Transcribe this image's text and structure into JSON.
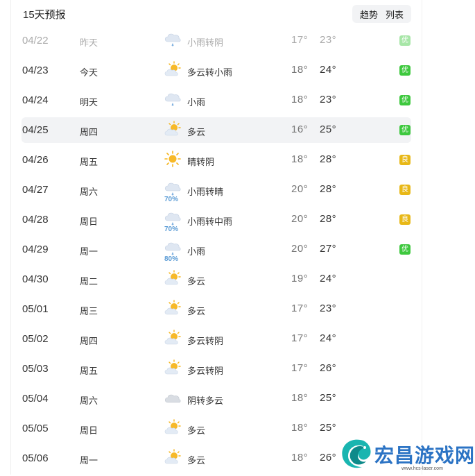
{
  "header": {
    "title": "15天预报",
    "trend_label": "趋势",
    "list_label": "列表"
  },
  "rows": [
    {
      "date": "04/22",
      "day": "昨天",
      "icon": "light-rain-icon",
      "pop": "",
      "condition": "小雨转阴",
      "low": "17°",
      "high": "23°",
      "aqi": "优",
      "aqi_level": "good",
      "past": true
    },
    {
      "date": "04/23",
      "day": "今天",
      "icon": "partly-cloudy-icon",
      "pop": "",
      "condition": "多云转小雨",
      "low": "18°",
      "high": "24°",
      "aqi": "优",
      "aqi_level": "good"
    },
    {
      "date": "04/24",
      "day": "明天",
      "icon": "light-rain-icon",
      "pop": "",
      "condition": "小雨",
      "low": "18°",
      "high": "23°",
      "aqi": "优",
      "aqi_level": "good"
    },
    {
      "date": "04/25",
      "day": "周四",
      "icon": "partly-cloudy-icon",
      "pop": "",
      "condition": "多云",
      "low": "16°",
      "high": "25°",
      "aqi": "优",
      "aqi_level": "good",
      "highlight": true
    },
    {
      "date": "04/26",
      "day": "周五",
      "icon": "sunny-icon",
      "pop": "",
      "condition": "晴转阴",
      "low": "18°",
      "high": "28°",
      "aqi": "良",
      "aqi_level": "moderate"
    },
    {
      "date": "04/27",
      "day": "周六",
      "icon": "light-rain-icon",
      "pop": "70%",
      "condition": "小雨转晴",
      "low": "20°",
      "high": "28°",
      "aqi": "良",
      "aqi_level": "moderate"
    },
    {
      "date": "04/28",
      "day": "周日",
      "icon": "light-rain-icon",
      "pop": "70%",
      "condition": "小雨转中雨",
      "low": "20°",
      "high": "28°",
      "aqi": "良",
      "aqi_level": "moderate"
    },
    {
      "date": "04/29",
      "day": "周一",
      "icon": "light-rain-icon",
      "pop": "80%",
      "condition": "小雨",
      "low": "20°",
      "high": "27°",
      "aqi": "优",
      "aqi_level": "good"
    },
    {
      "date": "04/30",
      "day": "周二",
      "icon": "partly-cloudy-icon",
      "pop": "",
      "condition": "多云",
      "low": "19°",
      "high": "24°",
      "aqi": "",
      "aqi_level": ""
    },
    {
      "date": "05/01",
      "day": "周三",
      "icon": "partly-cloudy-icon",
      "pop": "",
      "condition": "多云",
      "low": "17°",
      "high": "23°",
      "aqi": "",
      "aqi_level": ""
    },
    {
      "date": "05/02",
      "day": "周四",
      "icon": "partly-cloudy-icon",
      "pop": "",
      "condition": "多云转阴",
      "low": "17°",
      "high": "24°",
      "aqi": "",
      "aqi_level": ""
    },
    {
      "date": "05/03",
      "day": "周五",
      "icon": "partly-cloudy-icon",
      "pop": "",
      "condition": "多云转阴",
      "low": "17°",
      "high": "26°",
      "aqi": "",
      "aqi_level": ""
    },
    {
      "date": "05/04",
      "day": "周六",
      "icon": "overcast-icon",
      "pop": "",
      "condition": "阴转多云",
      "low": "18°",
      "high": "25°",
      "aqi": "",
      "aqi_level": ""
    },
    {
      "date": "05/05",
      "day": "周日",
      "icon": "partly-cloudy-icon",
      "pop": "",
      "condition": "多云",
      "low": "18°",
      "high": "25°",
      "aqi": "",
      "aqi_level": ""
    },
    {
      "date": "05/06",
      "day": "周一",
      "icon": "partly-cloudy-icon",
      "pop": "",
      "condition": "多云",
      "low": "18°",
      "high": "26°",
      "aqi": "",
      "aqi_level": ""
    }
  ],
  "watermark": {
    "text": "宏昌游戏网",
    "url": "www.hcs-laser.com"
  },
  "colors": {
    "aqi_good": "#3ec83e",
    "aqi_moderate": "#e8b817",
    "accent_blue": "#2b73c4"
  }
}
